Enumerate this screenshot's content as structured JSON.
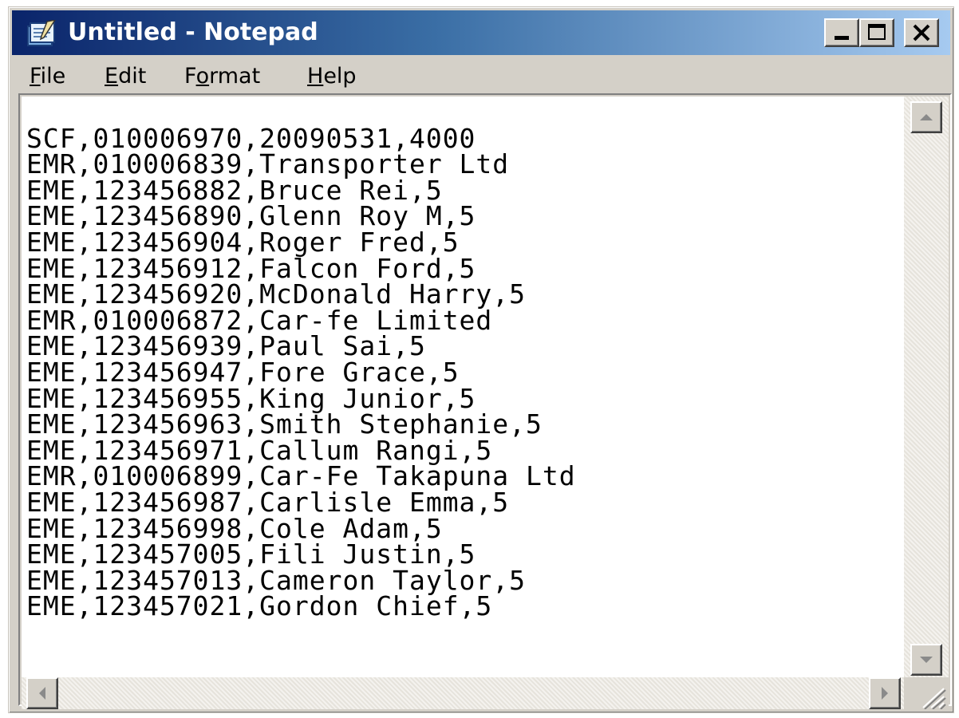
{
  "window": {
    "title": "Untitled - Notepad",
    "app_icon": "notepad-icon"
  },
  "menubar": {
    "items": [
      {
        "label": "File",
        "accel": "F",
        "rest": "ile"
      },
      {
        "label": "Edit",
        "accel": "E",
        "rest": "dit"
      },
      {
        "label": "Format",
        "pre": "F",
        "accel": "o",
        "rest": "rmat"
      },
      {
        "label": "Help",
        "accel": "H",
        "rest": "elp"
      }
    ]
  },
  "document": {
    "lines": [
      "SCF,010006970,20090531,4000",
      "EMR,010006839,Transporter Ltd",
      "EME,123456882,Bruce Rei,5",
      "EME,123456890,Glenn Roy M,5",
      "EME,123456904,Roger Fred,5",
      "EME,123456912,Falcon Ford,5",
      "EME,123456920,McDonald Harry,5",
      "EMR,010006872,Car-fe Limited",
      "EME,123456939,Paul Sai,5",
      "EME,123456947,Fore Grace,5",
      "EME,123456955,King Junior,5",
      "EME,123456963,Smith Stephanie,5",
      "EME,123456971,Callum Rangi,5",
      "EMR,010006899,Car-Fe Takapuna Ltd",
      "EME,123456987,Carlisle Emma,5",
      "EME,123456998,Cole Adam,5",
      "EME,123457005,Fili Justin,5",
      "EME,123457013,Cameron Taylor,5",
      "EME,123457021,Gordon Chief,5"
    ]
  },
  "colors": {
    "title_start": "#0a246a",
    "title_end": "#a6caf0",
    "chrome": "#d4d0c8"
  }
}
